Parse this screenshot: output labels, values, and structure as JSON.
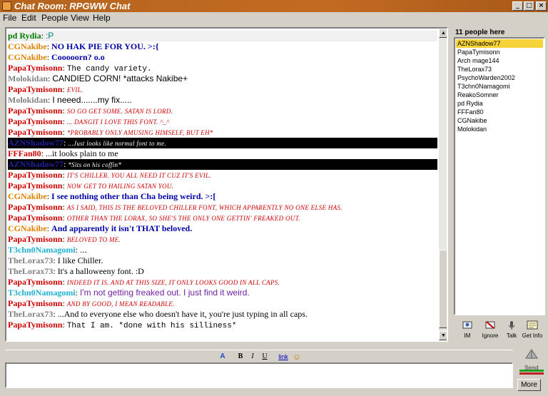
{
  "window": {
    "title": "Chat Room: RPGWW Chat",
    "controls": {
      "minimize": "_",
      "maximize": "□",
      "close": "×"
    }
  },
  "menu": [
    "File",
    "Edit",
    "People",
    "View",
    "Help"
  ],
  "chat": [
    {
      "nick": "pd Rydia",
      "nick_color": "#007800",
      "text": ":P",
      "text_color": "#008080",
      "font": "sans",
      "selected": true
    },
    {
      "nick": "CGNakibe",
      "nick_color": "#e08000",
      "text": "NO HAK PIE FOR YOU. >:{",
      "text_color": "#0000a8",
      "font": "serif-b"
    },
    {
      "nick": "CGNakibe",
      "nick_color": "#e08000",
      "text": "Cooooorn? o.o",
      "text_color": "#0000a8",
      "font": "serif-b"
    },
    {
      "nick": "PapaTymisonn",
      "nick_color": "#cc0000",
      "text": "The candy variety.",
      "text_color": "#000000",
      "font": "mono"
    },
    {
      "nick": "Molokidan",
      "nick_color": "#808080",
      "text": "CANDIED CORN! *attacks Nakibe+",
      "text_color": "#000000",
      "font": "sans"
    },
    {
      "nick": "PapaTymisonn",
      "nick_color": "#cc0000",
      "text": "EVIL.",
      "text_color": "#cc0000",
      "font": "chill"
    },
    {
      "nick": "Molokidan",
      "nick_color": "#808080",
      "text": "I neeed.......my fix.....",
      "text_color": "#000000",
      "font": "sans"
    },
    {
      "nick": "PapaTymisonn",
      "nick_color": "#cc0000",
      "text": "SO GO GET SOME. SATAN IS LORD.",
      "text_color": "#cc0000",
      "font": "chill"
    },
    {
      "nick": "PapaTymisonn",
      "nick_color": "#cc0000",
      "text": "... DANGIT I LOVE THIS FONT. ^_^",
      "text_color": "#cc0000",
      "font": "chill"
    },
    {
      "nick": "PapaTymisonn",
      "nick_color": "#cc0000",
      "text": "*PROBABLY ONLY AMUSING HIMSELF, BUT EH*",
      "text_color": "#cc0000",
      "font": "chill"
    },
    {
      "nick": "AZNShadow77",
      "nick_color": "#2020a0",
      "text": "...Just looks like normal font to me.",
      "text_color": "#ffffff",
      "font": "chill",
      "dark": true
    },
    {
      "nick": "FFFan80",
      "nick_color": "#cc0000",
      "text": "...it looks plain to me",
      "text_color": "#000000",
      "font": "serif"
    },
    {
      "nick": "AZNShadow77",
      "nick_color": "#2020a0",
      "text": "*Sits on his coffin*",
      "text_color": "#ffffff",
      "font": "chill",
      "dark": true
    },
    {
      "nick": "PapaTymisonn",
      "nick_color": "#cc0000",
      "text": "IT'S CHILLER. YOU ALL NEED IT CUZ IT'S EVIL.",
      "text_color": "#cc0000",
      "font": "chill"
    },
    {
      "nick": "PapaTymisonn",
      "nick_color": "#cc0000",
      "text": "NOW GET TO HAILING SATAN YOU.",
      "text_color": "#cc0000",
      "font": "chill"
    },
    {
      "nick": "CGNakibe",
      "nick_color": "#e08000",
      "text": "I see nothing other than Cha being weird. >:[",
      "text_color": "#0000a8",
      "font": "serif-b"
    },
    {
      "nick": "PapaTymisonn",
      "nick_color": "#cc0000",
      "text": "AS I SAID, THIS IS THE BELOVED CHILLER FONT, WHICH APPARENTLY NO ONE ELSE HAS.",
      "text_color": "#cc0000",
      "font": "chill"
    },
    {
      "nick": "PapaTymisonn",
      "nick_color": "#cc0000",
      "text": "OTHER THAN THE LORAX, SO SHE'S THE ONLY ONE GETTIN' FREAKED OUT.",
      "text_color": "#cc0000",
      "font": "chill"
    },
    {
      "nick": "CGNakibe",
      "nick_color": "#e08000",
      "text": "And apparently it isn't THAT beloved.",
      "text_color": "#0000a8",
      "font": "serif-b"
    },
    {
      "nick": "PapaTymisonn",
      "nick_color": "#cc0000",
      "text": "BELOVED TO ME.",
      "text_color": "#cc0000",
      "font": "chill"
    },
    {
      "nick": "T3chn0Namagomi",
      "nick_color": "#20b0d0",
      "text": "...",
      "text_color": "#000000",
      "font": "sans"
    },
    {
      "nick": "TheLorax73",
      "nick_color": "#808080",
      "text": "I like Chiller.",
      "text_color": "#000000",
      "font": "serif"
    },
    {
      "nick": "TheLorax73",
      "nick_color": "#808080",
      "text": "It's a halloweeny font. :D",
      "text_color": "#000000",
      "font": "serif"
    },
    {
      "nick": "PapaTymisonn",
      "nick_color": "#cc0000",
      "text": "INDEED IT IS. AND AT THIS SIZE, IT ONLY LOOKS GOOD IN ALL CAPS.",
      "text_color": "#cc0000",
      "font": "chill"
    },
    {
      "nick": "T3chn0Namagomi",
      "nick_color": "#20b0d0",
      "text": "I'm not getting freaked out.  I just find it weird.",
      "text_color": "#7020a0",
      "font": "sans"
    },
    {
      "nick": "PapaTymisonn",
      "nick_color": "#cc0000",
      "text": "AND BY GOOD, I MEAN READABLE.",
      "text_color": "#cc0000",
      "font": "chill"
    },
    {
      "nick": "TheLorax73",
      "nick_color": "#808080",
      "text": "...And to everyone else who doesn't have it, you're just typing in all caps.",
      "text_color": "#000000",
      "font": "serif"
    },
    {
      "nick": "PapaTymisonn",
      "nick_color": "#cc0000",
      "text": "That I am. *done with his silliness*",
      "text_color": "#000000",
      "font": "mono"
    }
  ],
  "people": {
    "header": "11 people here",
    "list": [
      "AZNShadow77",
      "PapaTymisonn",
      "Arch mage144",
      "TheLorax73",
      "PsychoWarden2002",
      "T3chn0Namagomi",
      "ReakoSomner",
      "pd Rydia",
      "FFFan80",
      "CGNakibe",
      "Molokidan"
    ],
    "selected_index": 0
  },
  "actions": [
    {
      "label": "IM",
      "icon": "im-icon"
    },
    {
      "label": "Ignore",
      "icon": "ignore-icon"
    },
    {
      "label": "Talk",
      "icon": "talk-icon"
    },
    {
      "label": "Get Info",
      "icon": "info-icon"
    }
  ],
  "format_toolbar": {
    "font_size": "A",
    "bold": "B",
    "italic": "I",
    "underline": "U",
    "link": "link",
    "smiley": "☺"
  },
  "input": {
    "value": ""
  },
  "send": {
    "label": "Send"
  },
  "more_button": "More",
  "colors": {
    "title_bar": "#b5641d",
    "selected_user": "#f6d338",
    "chrome": "#d4d0c8"
  }
}
